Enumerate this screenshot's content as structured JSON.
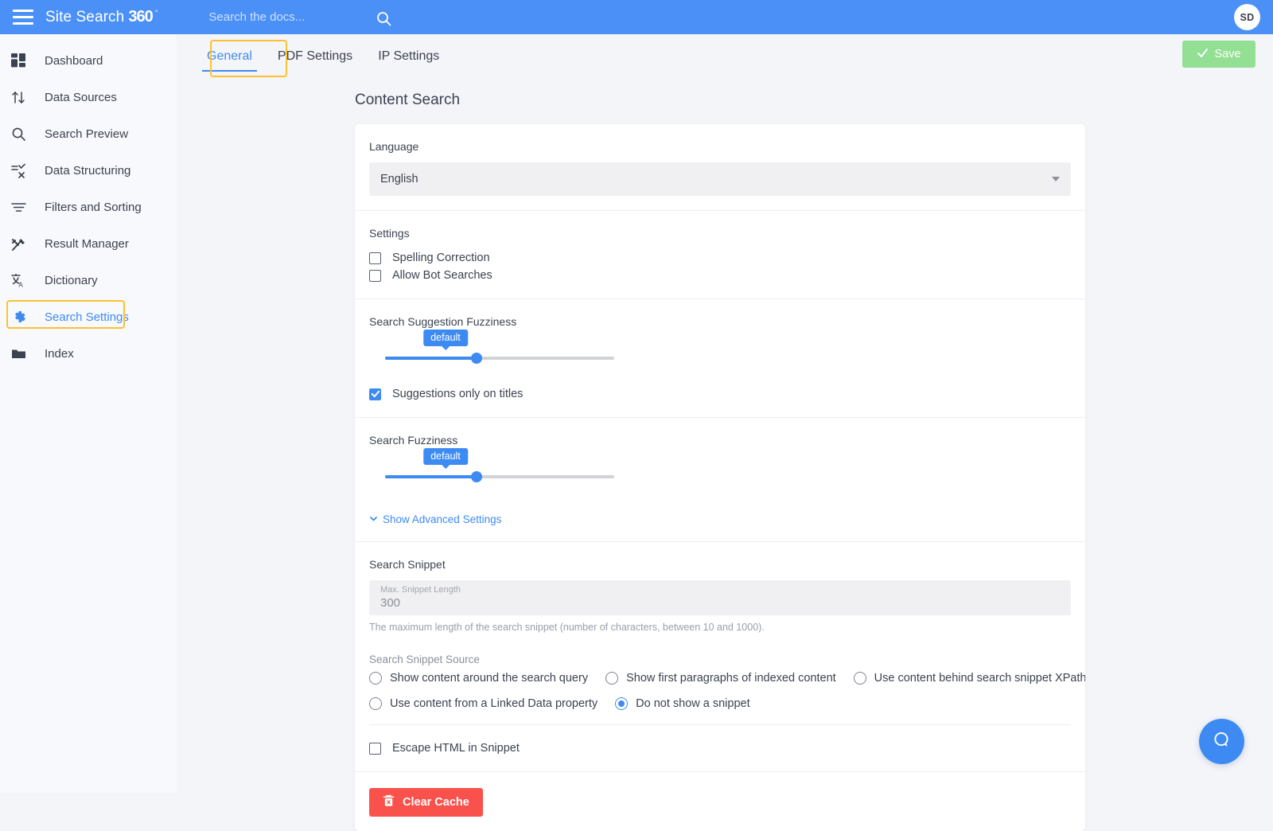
{
  "topbar": {
    "brand_prefix": "Site Search",
    "brand_suffix": "360",
    "brand_degree": "°",
    "search_placeholder": "Search the docs...",
    "avatar_initials": "SD",
    "accent": "#4a90f7"
  },
  "sidebar": {
    "items": [
      {
        "label": "Dashboard",
        "icon": "dashboard-icon",
        "active": false
      },
      {
        "label": "Data Sources",
        "icon": "data-sources-icon",
        "active": false
      },
      {
        "label": "Search Preview",
        "icon": "search-icon",
        "active": false
      },
      {
        "label": "Data Structuring",
        "icon": "data-structuring-icon",
        "active": false
      },
      {
        "label": "Filters and Sorting",
        "icon": "filter-icon",
        "active": false
      },
      {
        "label": "Result Manager",
        "icon": "tools-icon",
        "active": false
      },
      {
        "label": "Dictionary",
        "icon": "translate-icon",
        "active": false
      },
      {
        "label": "Search Settings",
        "icon": "gear-icon",
        "active": true
      },
      {
        "label": "Index",
        "icon": "folder-icon",
        "active": false
      }
    ],
    "highlight_color": "#fcc133",
    "active_color": "#3d8bf2"
  },
  "tabs": [
    {
      "label": "General",
      "active": true,
      "highlighted": true
    },
    {
      "label": "PDF Settings",
      "active": false,
      "highlighted": false
    },
    {
      "label": "IP Settings",
      "active": false,
      "highlighted": false
    }
  ],
  "save": {
    "label": "Save",
    "icon": "check-icon",
    "color": "#93df93",
    "enabled": false
  },
  "page": {
    "title": "Content Search"
  },
  "language": {
    "label": "Language",
    "selected": "English",
    "options": [
      "English"
    ]
  },
  "settings": {
    "label": "Settings",
    "checkboxes": [
      {
        "label": "Spelling Correction",
        "checked": false
      },
      {
        "label": "Allow Bot Searches",
        "checked": false
      }
    ]
  },
  "suggestion_fuzziness": {
    "label": "Search Suggestion Fuzziness",
    "badge": "default",
    "value_percent": 40,
    "checkbox": {
      "label": "Suggestions only on titles",
      "checked": true
    }
  },
  "search_fuzziness": {
    "label": "Search Fuzziness",
    "badge": "default",
    "value_percent": 40,
    "advanced_link": "Show Advanced Settings",
    "advanced_icon": "chevron-down-icon"
  },
  "snippet": {
    "label": "Search Snippet",
    "field_label": "Max. Snippet Length",
    "field_value": "300",
    "helper": "The maximum length of the search snippet (number of characters, between 10 and 1000).",
    "source_label": "Search Snippet Source",
    "source_options": [
      {
        "label": "Show content around the search query",
        "selected": false
      },
      {
        "label": "Show first paragraphs of indexed content",
        "selected": false
      },
      {
        "label": "Use content behind search snippet XPath",
        "selected": false
      },
      {
        "label": "Use content from a Linked Data property",
        "selected": false
      },
      {
        "label": "Do not show a snippet",
        "selected": true
      }
    ],
    "escape_html": {
      "label": "Escape HTML in Snippet",
      "checked": false
    }
  },
  "clear_cache": {
    "label": "Clear Cache",
    "icon": "trash-x-icon",
    "color": "#f9514b"
  },
  "help": {
    "icon": "chat-bubble-icon",
    "color": "#3d8bf2"
  }
}
